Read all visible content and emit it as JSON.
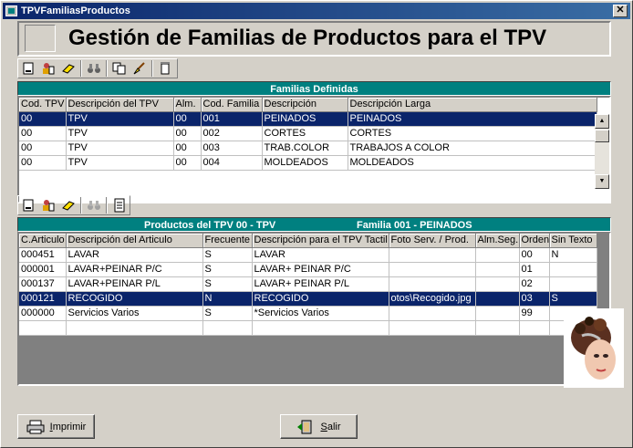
{
  "window": {
    "title": "TPVFamiliasProductos",
    "close_label": "✕"
  },
  "header": {
    "title": "Gestión de Familias de Productos para el TPV"
  },
  "families_panel": {
    "heading": "Familias Definidas",
    "columns": [
      "Cod. TPV",
      "Descripción del TPV",
      "Alm.",
      "Cod. Familia",
      "Descripción",
      "Descripción Larga"
    ],
    "rows": [
      [
        "00",
        "TPV",
        "00",
        "001",
        "PEINADOS",
        "PEINADOS"
      ],
      [
        "00",
        "TPV",
        "00",
        "002",
        "CORTES",
        "CORTES"
      ],
      [
        "00",
        "TPV",
        "00",
        "003",
        "TRAB.COLOR",
        "TRABAJOS A COLOR"
      ],
      [
        "00",
        "TPV",
        "00",
        "004",
        "MOLDEADOS",
        "MOLDEADOS"
      ]
    ],
    "selected_row": 0
  },
  "products_panel": {
    "heading_tpv": "Productos del TPV 00 - TPV",
    "heading_family": "Familia 001 - PEINADOS",
    "columns": [
      "C.Articulo",
      "Descripción del Articulo",
      "Frecuente",
      "Descripción para el TPV Tactil",
      "Foto Serv. / Prod.",
      "Alm.Seg.",
      "Orden",
      "Sin Texto"
    ],
    "rows": [
      [
        "000451",
        "LAVAR",
        "S",
        "LAVAR",
        "",
        "",
        "00",
        "N"
      ],
      [
        "000001",
        "LAVAR+PEINAR P/C",
        "S",
        "LAVAR+ PEINAR P/C",
        "",
        "",
        "01",
        ""
      ],
      [
        "000137",
        "LAVAR+PEINAR P/L",
        "S",
        "LAVAR+ PEINAR P/L",
        "",
        "",
        "02",
        ""
      ],
      [
        "000121",
        "RECOGIDO",
        "N",
        "RECOGIDO",
        "otos\\Recogido.jpg",
        "",
        "03",
        "S"
      ],
      [
        "000000",
        "Servicios Varios",
        "S",
        "*Servicios Varios",
        "",
        "",
        "99",
        ""
      ]
    ],
    "selected_row": 3
  },
  "toolbar1_icons": [
    "new-document-icon",
    "edit-user-icon",
    "eraser-icon",
    "binoculars-icon",
    "copy-icon",
    "brush-icon",
    "delete-icon"
  ],
  "toolbar2_icons": [
    "new-document-icon",
    "edit-user-icon",
    "eraser-icon",
    "binoculars-icon",
    "list-icon"
  ],
  "buttons": {
    "print": "Imprimir",
    "exit": "Salir"
  },
  "colors": {
    "panel_head": "#008080",
    "selection": "#0a246a",
    "window_bg": "#d4d0c8",
    "titlebar": "#0a246a"
  }
}
